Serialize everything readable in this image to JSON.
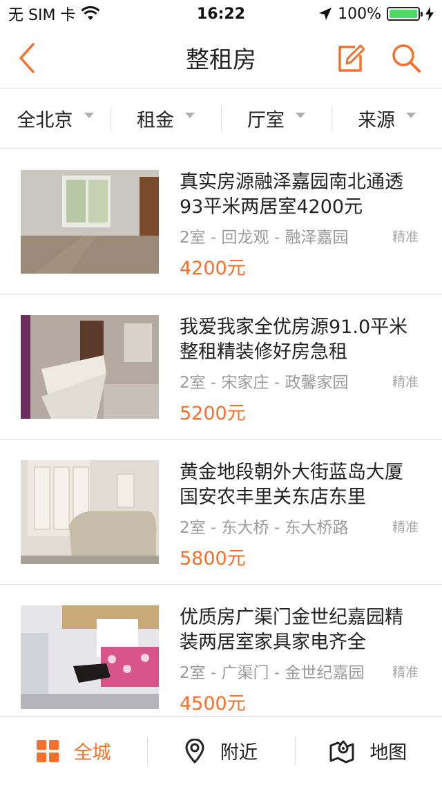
{
  "status_bar": {
    "carrier": "无 SIM 卡",
    "time": "16:22",
    "battery": "100%",
    "battery_level": 1.0
  },
  "nav": {
    "title": "整租房"
  },
  "filters": [
    {
      "label": "全北京"
    },
    {
      "label": "租金"
    },
    {
      "label": "厅室"
    },
    {
      "label": "来源"
    }
  ],
  "listings": [
    {
      "title": "真实房源融泽嘉园南北通透93平米两居室4200元",
      "meta": "2室 - 回龙观 - 融泽嘉园",
      "tag": "精准",
      "price": "4200元",
      "photo": "empty-room"
    },
    {
      "title": "我爱我家全优房源91.0平米整租精装修好房急租",
      "meta": "2室 - 宋家庄 - 政馨家园",
      "tag": "精准",
      "price": "5200元",
      "photo": "living-room-sofa"
    },
    {
      "title": "黄金地段朝外大街蓝岛大厦国安农丰里关东店东里",
      "meta": "2室 - 东大桥 - 东大桥路",
      "tag": "精准",
      "price": "5800元",
      "photo": "leather-sofa"
    },
    {
      "title": "优质房广渠门金世纪嘉园精装两居室家具家电齐全",
      "meta": "2室 - 广渠门 - 金世纪嘉园",
      "tag": "精准",
      "price": "4500元",
      "photo": "floral-sofa"
    }
  ],
  "tabs": [
    {
      "label": "全城",
      "icon": "grid-icon",
      "active": true
    },
    {
      "label": "附近",
      "icon": "location-pin-icon",
      "active": false
    },
    {
      "label": "地图",
      "icon": "map-icon",
      "active": false
    }
  ],
  "colors": {
    "accent": "#f6702b",
    "battery": "#4cd964",
    "divider": "#dcdcdc",
    "meta_text": "#9a9a9a"
  }
}
